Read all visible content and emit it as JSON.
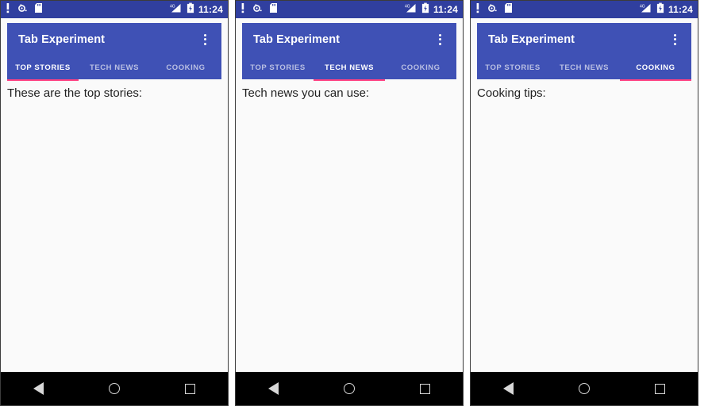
{
  "status_bar": {
    "time": "11:24",
    "left_icons": [
      "alert-exclamation-icon",
      "bug-report-icon",
      "sd-card-icon"
    ],
    "right_icons": [
      "signal-4g-icon",
      "battery-charging-icon"
    ],
    "background_color": "#303F9F",
    "text_color": "#FFFFFF"
  },
  "app": {
    "title": "Tab Experiment",
    "overflow_menu_icon": "more-vert-icon",
    "primary_color": "#3F51B5",
    "accent_color": "#FF4081",
    "content_background": "#FAFAFA"
  },
  "tabs": [
    {
      "label": "TOP STORIES"
    },
    {
      "label": "TECH NEWS"
    },
    {
      "label": "COOKING"
    }
  ],
  "nav_bar": {
    "background_color": "#000000",
    "buttons": [
      {
        "name": "back",
        "icon": "back-triangle-icon"
      },
      {
        "name": "home",
        "icon": "home-circle-icon"
      },
      {
        "name": "recents",
        "icon": "recents-square-icon"
      }
    ]
  },
  "screens": [
    {
      "active_tab_index": 0,
      "body_text": "These are the top stories:"
    },
    {
      "active_tab_index": 1,
      "body_text": "Tech news you can use:"
    },
    {
      "active_tab_index": 2,
      "body_text": "Cooking tips:"
    }
  ]
}
